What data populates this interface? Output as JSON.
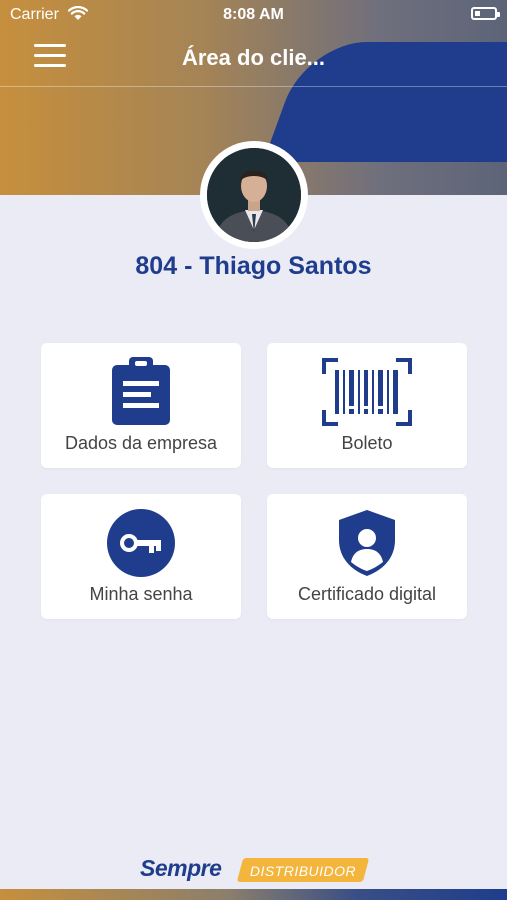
{
  "status_bar": {
    "carrier": "Carrier",
    "time": "8:08 AM",
    "battery_level": 0.15
  },
  "header": {
    "title": "Área do clie...",
    "menu_icon": "hamburger-icon"
  },
  "profile": {
    "name": "804 - Thiago Santos",
    "avatar_alt": "Foto do cliente"
  },
  "menu": [
    {
      "label": "Dados da empresa",
      "icon": "clipboard-icon"
    },
    {
      "label": "Boleto",
      "icon": "barcode-icon"
    },
    {
      "label": "Minha senha",
      "icon": "key-icon"
    },
    {
      "label": "Certificado digital",
      "icon": "shield-user-icon"
    }
  ],
  "footer": {
    "brand": "Sempre",
    "tag": "DISTRIBUIDOR"
  },
  "colors": {
    "primary_blue": "#1f3d8c",
    "gold": "#c68f3d",
    "background": "#ebebf5",
    "tag_yellow": "#f3b53c"
  }
}
